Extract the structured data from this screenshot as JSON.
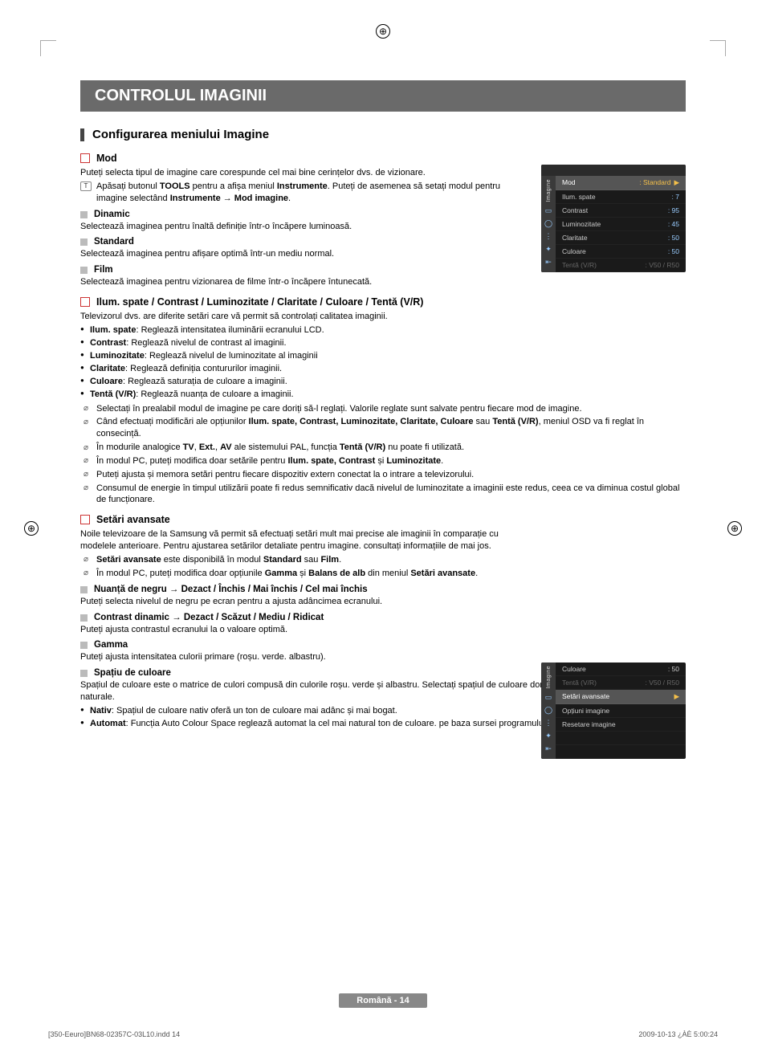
{
  "title": "CONTROLUL IMAGINII",
  "section1": "Configurarea meniului Imagine",
  "mod": {
    "label": "Mod",
    "desc": "Puteți selecta tipul de imagine care corespunde cel mai bine cerințelor dvs. de vizionare.",
    "tools_pre": "Apăsați butonul ",
    "tools_b1": "TOOLS",
    "tools_mid1": " pentru a afișa meniul ",
    "tools_b2": "Instrumente",
    "tools_mid2": ". Puteți de asemenea să setați modul pentru imagine selectând ",
    "tools_b3": "Instrumente → Mod imagine",
    "tools_end": "."
  },
  "dinamic": {
    "label": "Dinamic",
    "desc": "Selectează imaginea pentru înaltă definiție într-o încăpere luminoasă."
  },
  "standard": {
    "label": "Standard",
    "desc": "Selectează imaginea pentru afișare optimă într-un mediu normal."
  },
  "film": {
    "label": "Film",
    "desc": "Selectează imaginea pentru vizionarea de filme într-o încăpere întunecată."
  },
  "ilum": {
    "label": "Ilum. spate / Contrast / Luminozitate / Claritate / Culoare / Tentă (V/R)",
    "intro": "Televizorul dvs. are diferite setări care vă permit să controlați calitatea imaginii.",
    "b1": "Ilum. spate",
    "b1t": ": Reglează intensitatea iluminării ecranului LCD.",
    "b2": "Contrast",
    "b2t": ": Reglează nivelul de contrast al imaginii.",
    "b3": "Luminozitate",
    "b3t": ": Reglează nivelul de luminozitate al imaginii",
    "b4": "Claritate",
    "b4t": ": Reglează definiția contururilor imaginii.",
    "b5": "Culoare",
    "b5t": ": Reglează saturația de culoare a imaginii.",
    "b6": "Tentă (V/R)",
    "b6t": ": Reglează nuanța de culoare a imaginii.",
    "n1": "Selectați în prealabil modul de imagine pe care doriți să-l reglați. Valorile reglate sunt salvate pentru fiecare mod de imagine.",
    "n2a": "Când efectuați modificări ale opțiunilor ",
    "n2b": "Ilum. spate, Contrast, Luminozitate, Claritate, Culoare",
    "n2c": " sau ",
    "n2d": "Tentă (V/R)",
    "n2e": ", meniul OSD va fi reglat în consecință.",
    "n3a": "În modurile analogice ",
    "n3b": "TV",
    "n3c": ", ",
    "n3d": "Ext.",
    "n3e": ", ",
    "n3f": "AV",
    "n3g": " ale sistemului PAL, funcția ",
    "n3h": "Tentă (V/R)",
    "n3i": " nu poate fi utilizată.",
    "n4a": "În modul PC, puteți modifica doar setările pentru ",
    "n4b": "Ilum. spate, Contrast",
    "n4c": " și ",
    "n4d": "Luminozitate",
    "n4e": ".",
    "n5": "Puteți ajusta și memora setări pentru fiecare dispozitiv extern conectat la o intrare a televizorului.",
    "n6": "Consumul de energie în timpul utilizării poate fi redus semnificativ dacă nivelul de luminozitate a imaginii este redus, ceea ce va diminua costul global de funcționare."
  },
  "setari": {
    "label": "Setări avansate",
    "intro": "Noile televizoare de la Samsung vă permit să efectuați setări mult mai precise ale imaginii în comparație cu modelele anterioare. Pentru ajustarea setărilor detaliate pentru imagine. consultați informațiile de mai jos.",
    "n1a": "Setări avansate",
    "n1b": " este disponibilă în modul ",
    "n1c": "Standard",
    "n1d": " sau ",
    "n1e": "Film",
    "n1f": ".",
    "n2a": "În modul PC, puteți modifica doar opțiunile ",
    "n2b": "Gamma",
    "n2c": " și ",
    "n2d": "Balans de alb",
    "n2e": " din meniul ",
    "n2f": "Setări avansate",
    "n2g": "."
  },
  "nuanta": {
    "label": "Nuanță de negru → Dezact / Închis / Mai închis / Cel mai închis",
    "desc": "Puteți selecta nivelul de negru pe ecran pentru a ajusta adâncimea ecranului."
  },
  "contrastd": {
    "label": "Contrast dinamic → Dezact / Scăzut / Mediu / Ridicat",
    "desc": "Puteți ajusta contrastul ecranului la o valoare optimă."
  },
  "gamma": {
    "label": "Gamma",
    "desc": "Puteți ajusta intensitatea culorii primare (roșu. verde. albastru)."
  },
  "spatiu": {
    "label": "Spațiu de culoare",
    "desc": "Spațiul de culoare este o matrice de culori compusă din culorile roșu. verde și albastru. Selectați spațiul de culoare dorit și savurați culori extrem de naturale.",
    "b1": "Nativ",
    "b1t": ": Spațiul de culoare nativ oferă un ton de culoare mai adânc și mai bogat.",
    "b2": "Automat",
    "b2t": ": Funcția Auto Colour Space reglează automat la cel mai natural ton de culoare. pe baza sursei programului."
  },
  "osd1": {
    "tab": "Imagine",
    "hl_k": "Mod",
    "hl_v": ": Standard",
    "r1k": "Ilum. spate",
    "r1v": ": 7",
    "r2k": "Contrast",
    "r2v": ": 95",
    "r3k": "Luminozitate",
    "r3v": ": 45",
    "r4k": "Claritate",
    "r4v": ": 50",
    "r5k": "Culoare",
    "r5v": ": 50",
    "r6k": "Tentă (V/R)",
    "r6v": ": V50 / R50"
  },
  "osd2": {
    "tab": "Imagine",
    "r0k": "Culoare",
    "r0v": ": 50",
    "r1k": "Tentă (V/R)",
    "r1v": ": V50 / R50",
    "hl_k": "Setări avansate",
    "r2k": "Opțiuni imagine",
    "r3k": "Resetare imagine"
  },
  "footer": "Română - 14",
  "meta_left": "[350-Eeuro]BN68-02357C-03L10.indd   14",
  "meta_right": "2009-10-13   ¿ÀÈ 5:00:24"
}
